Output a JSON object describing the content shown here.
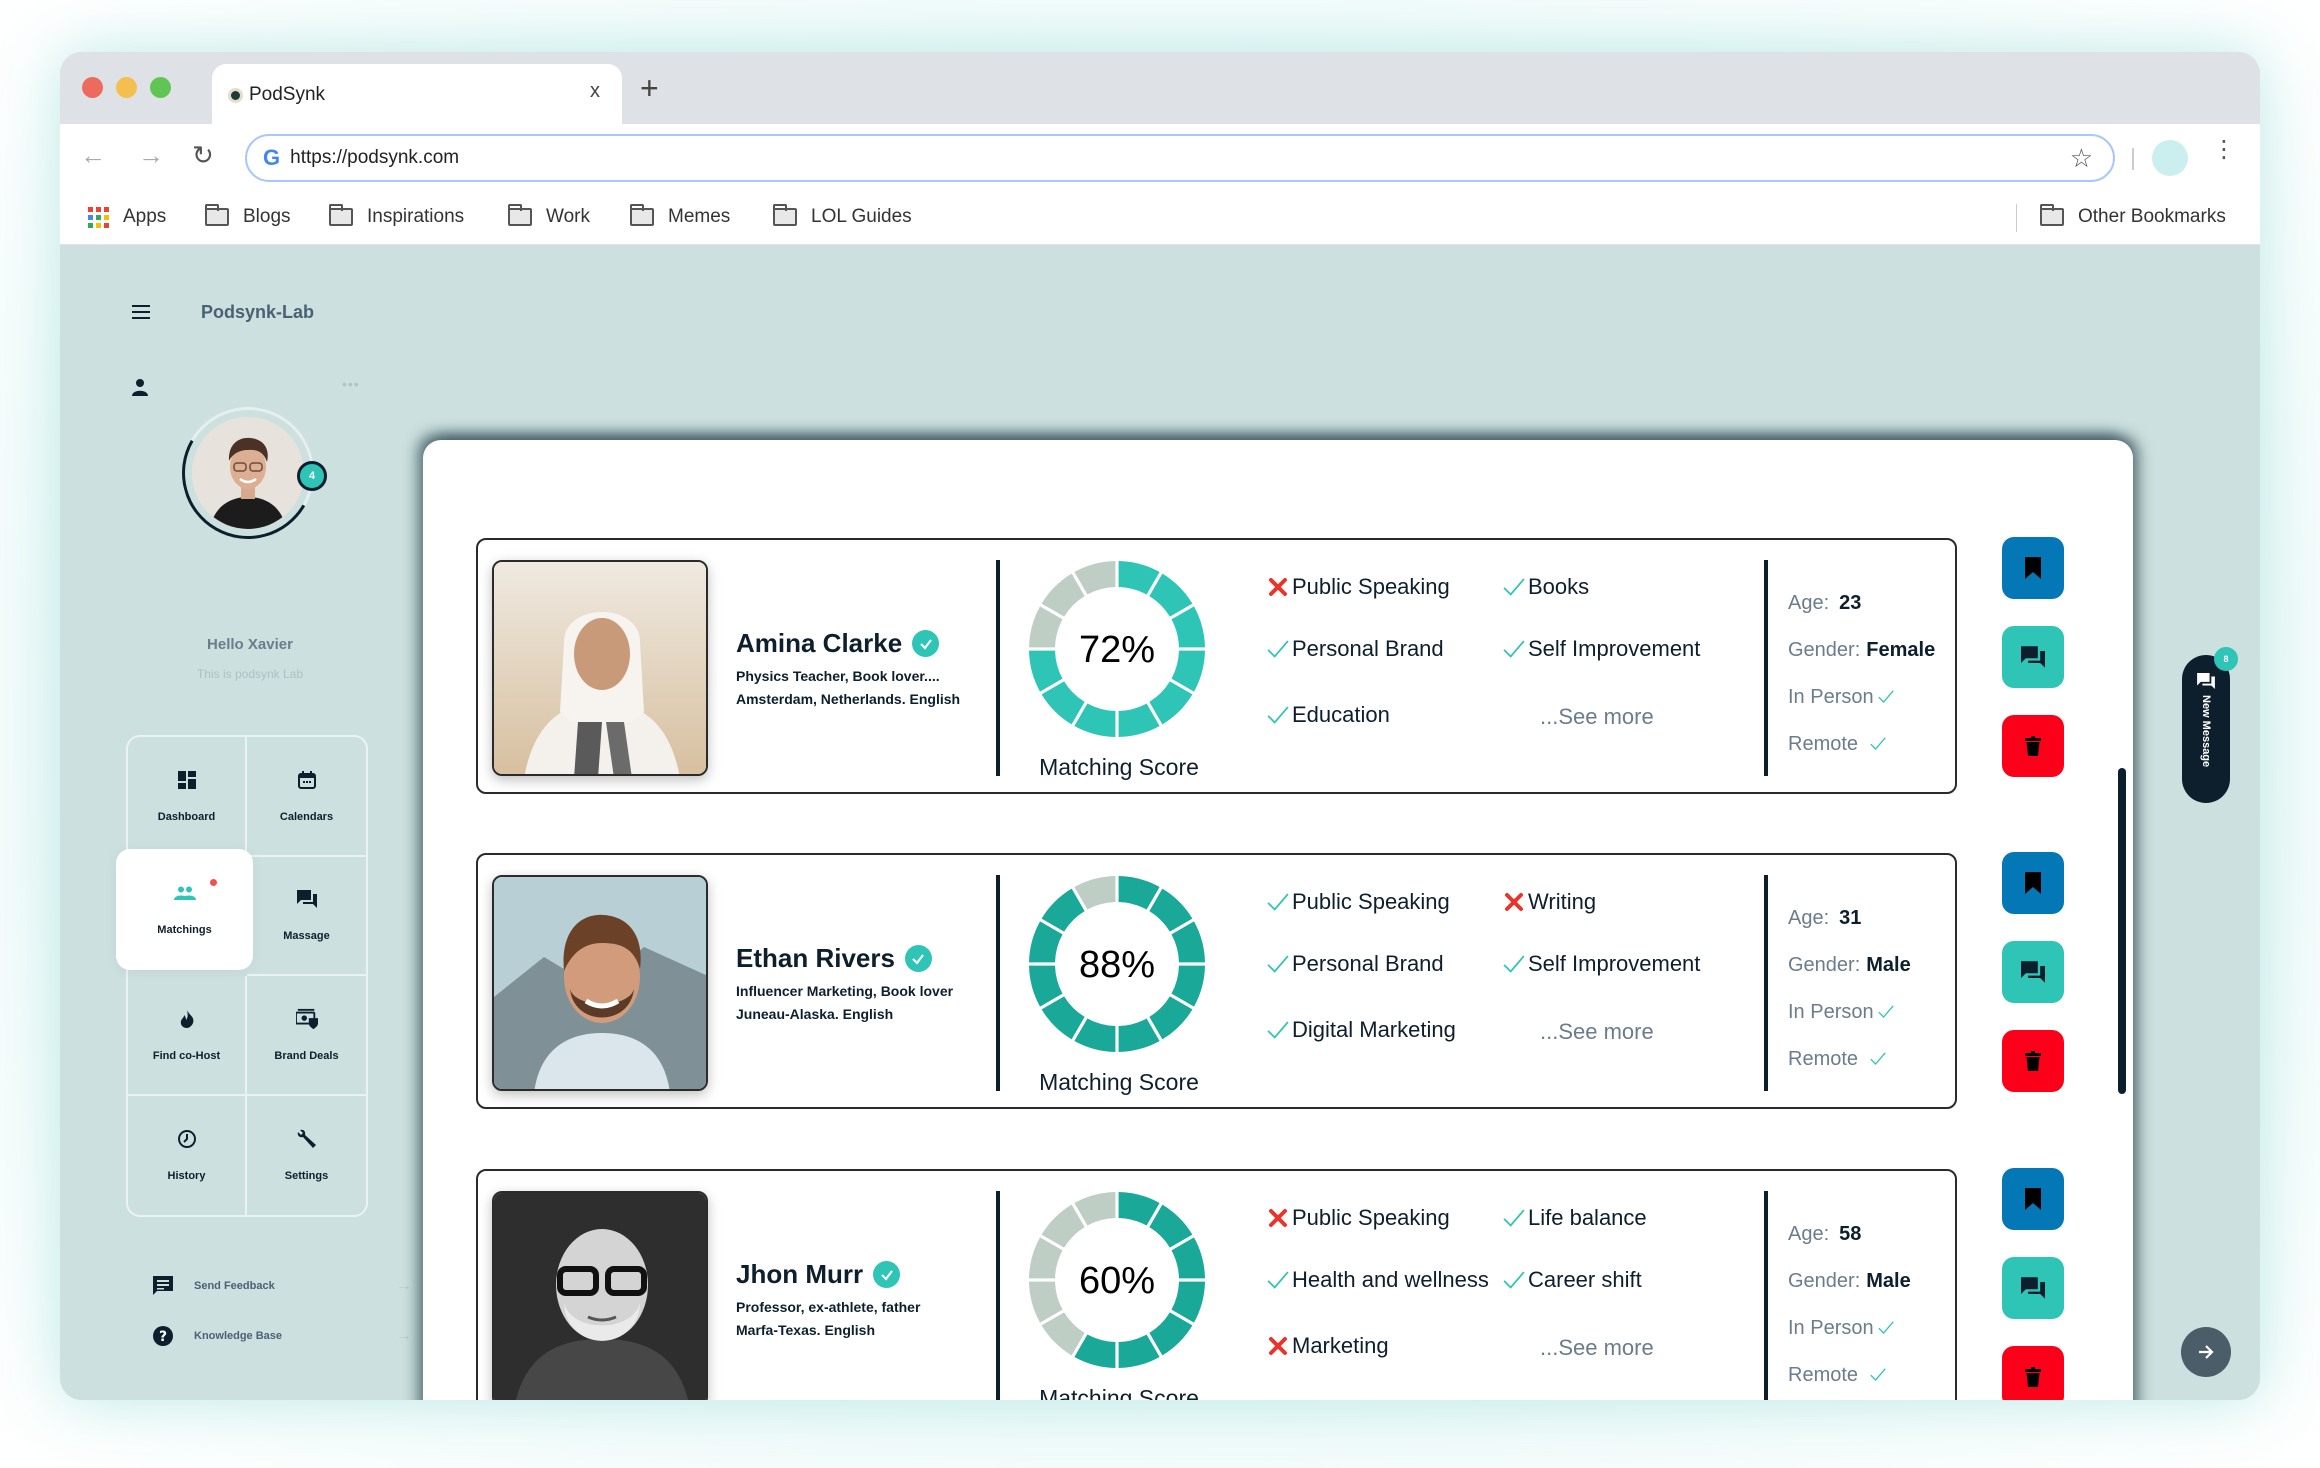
{
  "browser": {
    "tab_title": "PodSynk",
    "tab_close": "x",
    "new_tab": "+",
    "url": "https://podsynk.com",
    "bookmarks": [
      "Apps",
      "Blogs",
      "Inspirations",
      "Work",
      "Memes",
      "LOL Guides"
    ],
    "other_bookmarks": "Other Bookmarks"
  },
  "app": {
    "title": "Podsynk-Lab",
    "user": {
      "greeting": "Hello Xavier",
      "subtitle": "This is podsynk Lab",
      "notification_count": "4"
    },
    "nav": [
      {
        "label": "Dashboard",
        "icon": "dashboard-icon"
      },
      {
        "label": "Calendars",
        "icon": "calendar-icon"
      },
      {
        "label": "Matchings",
        "icon": "people-icon",
        "active": true,
        "has_dot": true
      },
      {
        "label": "Massage",
        "icon": "chat-icon"
      },
      {
        "label": "Find co-Host",
        "icon": "fire-icon"
      },
      {
        "label": "Brand Deals",
        "icon": "money-shield-icon"
      },
      {
        "label": "History",
        "icon": "history-icon"
      },
      {
        "label": "Settings",
        "icon": "wrench-icon"
      }
    ],
    "footer_links": [
      {
        "label": "Send Feedback",
        "icon": "feedback-icon"
      },
      {
        "label": "Knowledge  Base",
        "icon": "help-icon"
      }
    ],
    "new_message": {
      "label": "New Message",
      "count": "8"
    }
  },
  "colors": {
    "teal": "#2ec4b6",
    "teal_dark": "#1aa899",
    "grey_segment": "#bfcec5",
    "navy": "#0d1f2d",
    "bookmark_blue": "#0477b7",
    "delete_red": "#fc0019",
    "sidebar_bg": "#cce0df"
  },
  "matches": [
    {
      "name": "Amina Clarke",
      "bio_line1": "Physics Teacher, Book lover....",
      "bio_line2": " Amsterdam, Netherlands. English",
      "score": 72,
      "score_text": "72%",
      "score_label": "Matching Score",
      "tags": [
        {
          "label": "Public Speaking",
          "match": false
        },
        {
          "label": "Books",
          "match": true
        },
        {
          "label": "Personal Brand",
          "match": true
        },
        {
          "label": "Self Improvement",
          "match": true
        },
        {
          "label": "Education",
          "match": true
        }
      ],
      "see_more": "...See more",
      "age_label": "Age:",
      "age": "23",
      "gender_label": "Gender:",
      "gender": "Female",
      "in_person": "In Person",
      "remote": "Remote"
    },
    {
      "name": "Ethan Rivers",
      "bio_line1": "Influencer Marketing, Book lover",
      "bio_line2": "Juneau-Alaska. English",
      "score": 88,
      "score_text": "88%",
      "score_label": "Matching Score",
      "tags": [
        {
          "label": "Public Speaking",
          "match": true
        },
        {
          "label": "Writing",
          "match": false
        },
        {
          "label": "Personal Brand",
          "match": true
        },
        {
          "label": "Self Improvement",
          "match": true
        },
        {
          "label": "Digital Marketing",
          "match": true
        }
      ],
      "see_more": "...See more",
      "age_label": "Age:",
      "age": "31",
      "gender_label": "Gender:",
      "gender": "Male",
      "in_person": "In Person",
      "remote": "Remote"
    },
    {
      "name": "Jhon Murr",
      "bio_line1": "Professor, ex-athlete, father",
      "bio_line2": "Marfa-Texas. English",
      "score": 60,
      "score_text": "60%",
      "score_label": "Matching Score",
      "tags": [
        {
          "label": "Public Speaking",
          "match": false
        },
        {
          "label": "Life balance",
          "match": true
        },
        {
          "label": "Health and wellness",
          "match": true
        },
        {
          "label": "Career shift",
          "match": true
        },
        {
          "label": "Marketing",
          "match": false
        }
      ],
      "see_more": "...See more",
      "age_label": "Age:",
      "age": "58",
      "gender_label": "Gender:",
      "gender": "Male",
      "in_person": "In Person",
      "remote": "Remote"
    }
  ]
}
